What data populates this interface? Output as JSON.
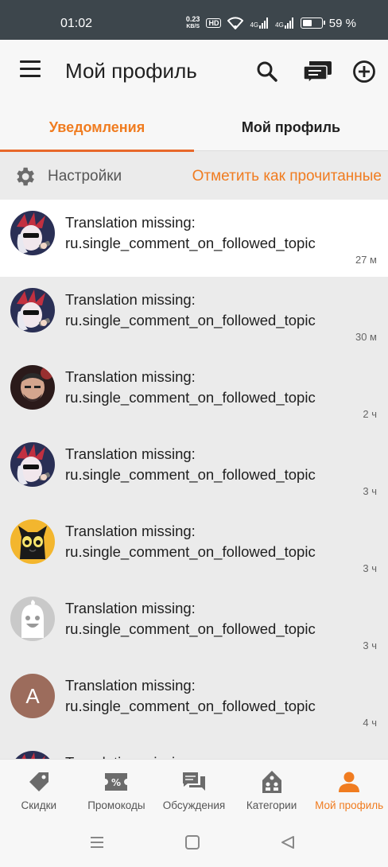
{
  "status": {
    "time": "01:02",
    "net_speed_value": "0.23",
    "net_speed_unit": "KB/S",
    "hd": "HD",
    "signal_1": "4G",
    "signal_2": "4G",
    "battery_percent": "59 %",
    "battery_level": 0.59
  },
  "app_bar": {
    "title": "Мой профиль",
    "icons": [
      "menu-icon",
      "search-icon",
      "chat-icon",
      "add-circle-icon"
    ]
  },
  "tabs": [
    {
      "label": "Уведомления",
      "active": true
    },
    {
      "label": "Мой профиль",
      "active": false
    }
  ],
  "settings": {
    "label": "Настройки",
    "mark_read": "Отметить как прочитанные"
  },
  "notifications": [
    {
      "line1": "Translation missing:",
      "line2": "ru.single_comment_on_followed_topic",
      "time": "27 м",
      "avatar": "punk-avatar",
      "unread": true
    },
    {
      "line1": "Translation missing:",
      "line2": "ru.single_comment_on_followed_topic",
      "time": "30 м",
      "avatar": "punk-avatar",
      "unread": false
    },
    {
      "line1": "Translation missing:",
      "line2": "ru.single_comment_on_followed_topic",
      "time": "2 ч",
      "avatar": "man-avatar",
      "unread": false
    },
    {
      "line1": "Translation missing:",
      "line2": "ru.single_comment_on_followed_topic",
      "time": "3 ч",
      "avatar": "punk-avatar",
      "unread": false
    },
    {
      "line1": "Translation missing:",
      "line2": "ru.single_comment_on_followed_topic",
      "time": "3 ч",
      "avatar": "cat-avatar",
      "unread": false
    },
    {
      "line1": "Translation missing:",
      "line2": "ru.single_comment_on_followed_topic",
      "time": "3 ч",
      "avatar": "ghost-avatar",
      "unread": false
    },
    {
      "line1": "Translation missing:",
      "line2": "ru.single_comment_on_followed_topic",
      "time": "4 ч",
      "avatar": "letter-avatar",
      "letter": "A",
      "unread": false
    },
    {
      "line1": "Translation missing:",
      "line2": "",
      "time": "",
      "avatar": "punk-avatar",
      "unread": false
    }
  ],
  "bottom_nav": [
    {
      "label": "Скидки",
      "icon": "tag-icon",
      "active": false
    },
    {
      "label": "Промокоды",
      "icon": "coupon-icon",
      "active": false
    },
    {
      "label": "Обсуждения",
      "icon": "forum-icon",
      "active": false
    },
    {
      "label": "Категории",
      "icon": "category-icon",
      "active": false
    },
    {
      "label": "Мой профиль",
      "icon": "person-icon",
      "active": true
    }
  ],
  "colors": {
    "accent": "#f07c20",
    "status_bar": "#3d464c",
    "unread_bg": "#ffffff",
    "read_bg": "#ebebeb"
  }
}
